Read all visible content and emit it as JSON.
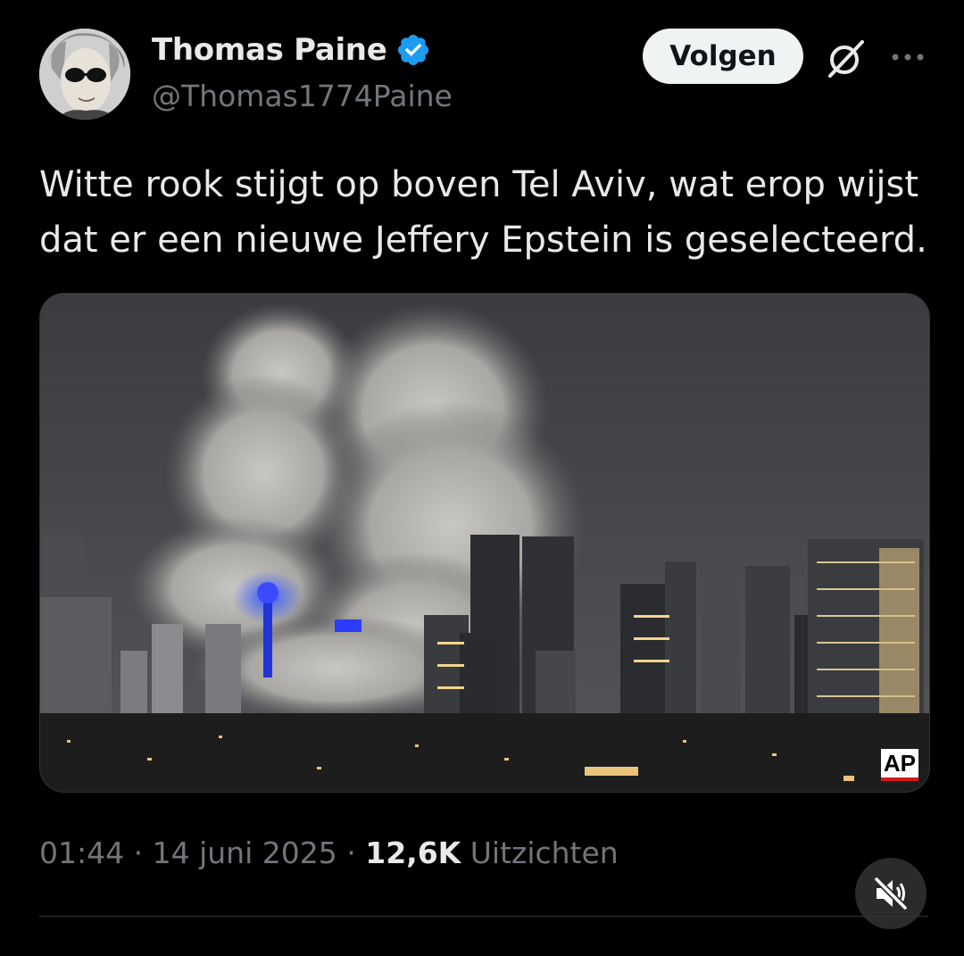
{
  "author": {
    "display_name": "Thomas Paine",
    "handle": "@Thomas1774Paine",
    "verified": true,
    "avatar_icon": "profile-avatar-sunglasses",
    "verified_color": "#1d9bf0"
  },
  "actions": {
    "follow_label": "Volgen",
    "grok_icon": "grok-icon",
    "more_icon": "more-dots-icon"
  },
  "tweet": {
    "text": "Witte rook stijgt op boven Tel Aviv, wat erop wijst\ndat er een nieuwe Jeffery Epstein is geselecteerd.",
    "media": {
      "description_icon": "city-skyline-smoke-image",
      "credit": "AP"
    }
  },
  "meta": {
    "time": "01:44",
    "date": "14 juni 2025",
    "separator": "·",
    "views_count": "12,6K",
    "views_label": "Uitzichten"
  },
  "video_controls": {
    "mute_icon": "muted-speaker-icon"
  }
}
